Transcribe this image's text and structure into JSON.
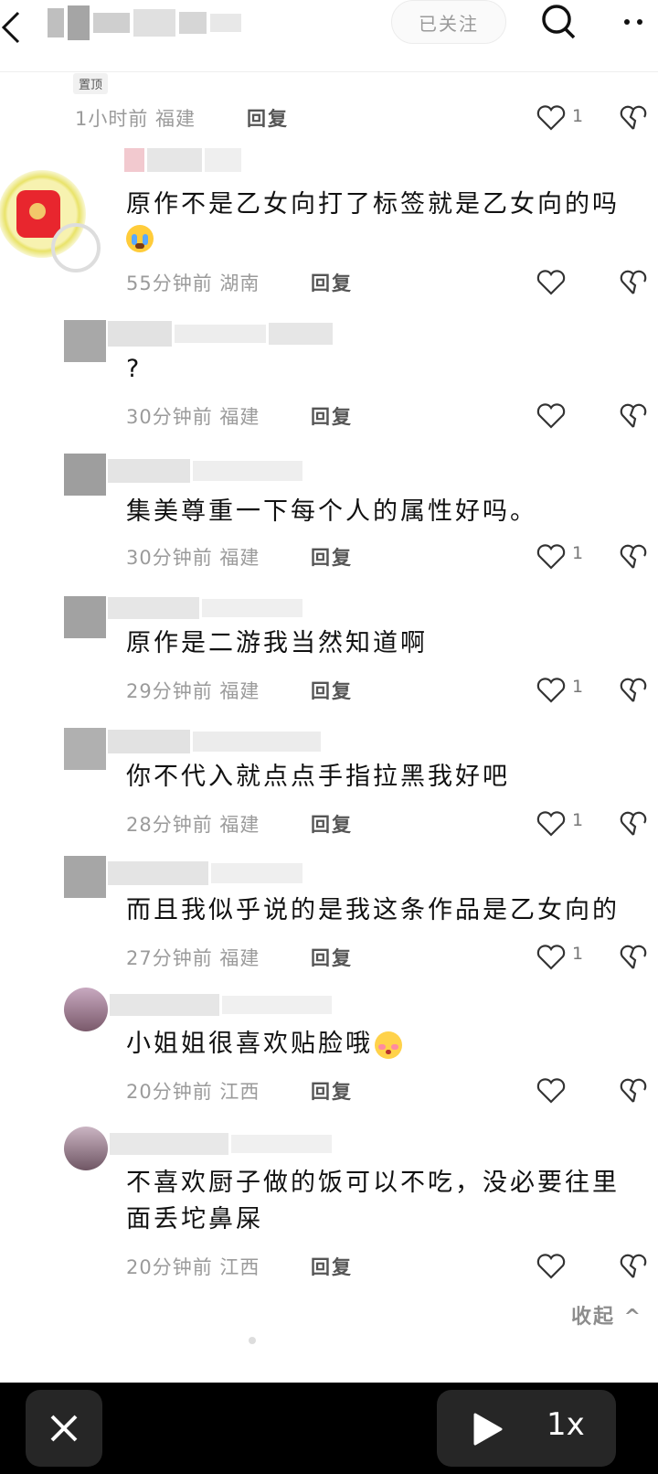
{
  "header": {
    "follow_label": "已关注"
  },
  "pinned": {
    "badge": "置顶",
    "meta": "1小时前 福建",
    "reply_label": "回复",
    "likes": "1"
  },
  "comments": [
    {
      "text": "原作不是乙女向打了标签就是乙女向的吗",
      "meta": "55分钟前 湖南",
      "reply": "回复",
      "likes": ""
    },
    {
      "text": "?",
      "meta": "30分钟前 福建",
      "reply": "回复",
      "likes": ""
    },
    {
      "text": "集美尊重一下每个人的属性好吗。",
      "meta": "30分钟前 福建",
      "reply": "回复",
      "likes": "1"
    },
    {
      "text": "原作是二游我当然知道啊",
      "meta": "29分钟前 福建",
      "reply": "回复",
      "likes": "1"
    },
    {
      "text": "你不代入就点点手指拉黑我好吧",
      "meta": "28分钟前 福建",
      "reply": "回复",
      "likes": "1"
    },
    {
      "text": "而且我似乎说的是我这条作品是乙女向的",
      "meta": "27分钟前 福建",
      "reply": "回复",
      "likes": "1"
    },
    {
      "text": "小姐姐很喜欢贴脸哦",
      "meta": "20分钟前 江西",
      "reply": "回复",
      "likes": ""
    },
    {
      "text_line1": "不喜欢厨子做的饭可以不吃，没必要往里",
      "text_line2": "面丢坨鼻屎",
      "meta": "20分钟前 江西",
      "reply": "回复",
      "likes": ""
    }
  ],
  "collapse_label": "收起 ^",
  "bottom": {
    "speed": "1x"
  },
  "icons": [
    "back-icon",
    "search-icon",
    "more-icon",
    "heart-icon",
    "broken-heart-icon",
    "close-icon",
    "play-icon",
    "crying-emoji-icon",
    "blush-emoji-icon"
  ]
}
